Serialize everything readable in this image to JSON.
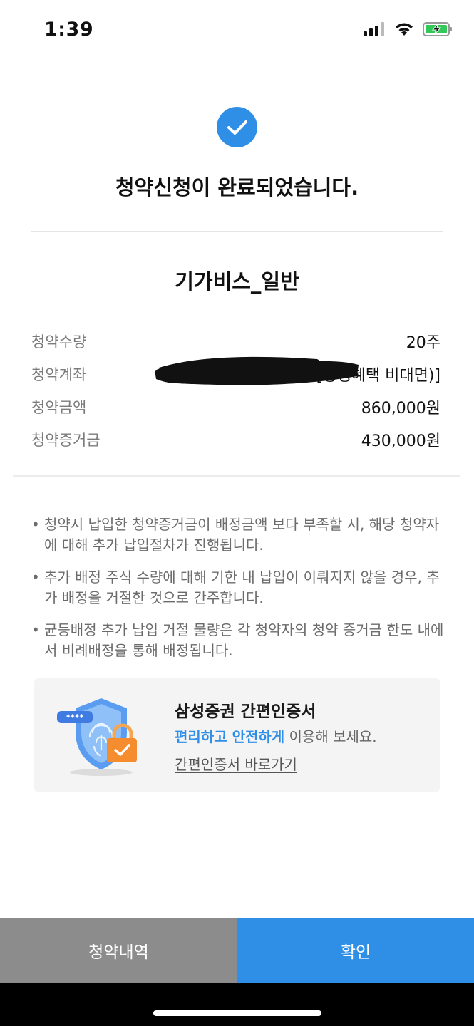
{
  "status_bar": {
    "time": "1:39",
    "icons": [
      "cellular-signal-icon",
      "wifi-icon",
      "battery-charging-icon"
    ]
  },
  "header": {
    "icon": "check-circle-icon",
    "title": "청약신청이 완료되었습니다."
  },
  "product": {
    "name": "기가비스_일반"
  },
  "details": [
    {
      "label": "청약수량",
      "value": "20주"
    },
    {
      "label": "청약계좌",
      "value": "[평생혜택 비대면)]"
    },
    {
      "label": "청약금액",
      "value": "860,000원"
    },
    {
      "label": "청약증거금",
      "value": "430,000원"
    }
  ],
  "notices": [
    {
      "bullet": "•",
      "text": "청약시 납입한 청약증거금이 배정금액 보다 부족할 시, 해당 청약자에 대해 추가 납입절차가 진행됩니다."
    },
    {
      "bullet": "•",
      "text": "추가 배정 주식 수량에 대해 기한 내 납입이 이뤄지지 않을 경우, 추가 배정을 거절한 것으로 간주합니다."
    },
    {
      "bullet": "•",
      "text": "균등배정 추가 납입 거절 물량은 각 청약자의 청약 증거금 한도 내에서 비례배정을 통해 배정됩니다."
    }
  ],
  "cert_card": {
    "title": "삼성증권 간편인증서",
    "desc_highlight": "편리하고 안전하게",
    "desc_rest": " 이용해 보세요.",
    "link": "간편인증서 바로가기",
    "password_mask": "****",
    "icon": "shield-fingerprint-lock-icon"
  },
  "buttons": {
    "history": "청약내역",
    "confirm": "확인"
  },
  "colors": {
    "accent": "#2f8ee6",
    "secondary_button": "#8c8c8c",
    "muted_text": "#7b7b7b"
  }
}
